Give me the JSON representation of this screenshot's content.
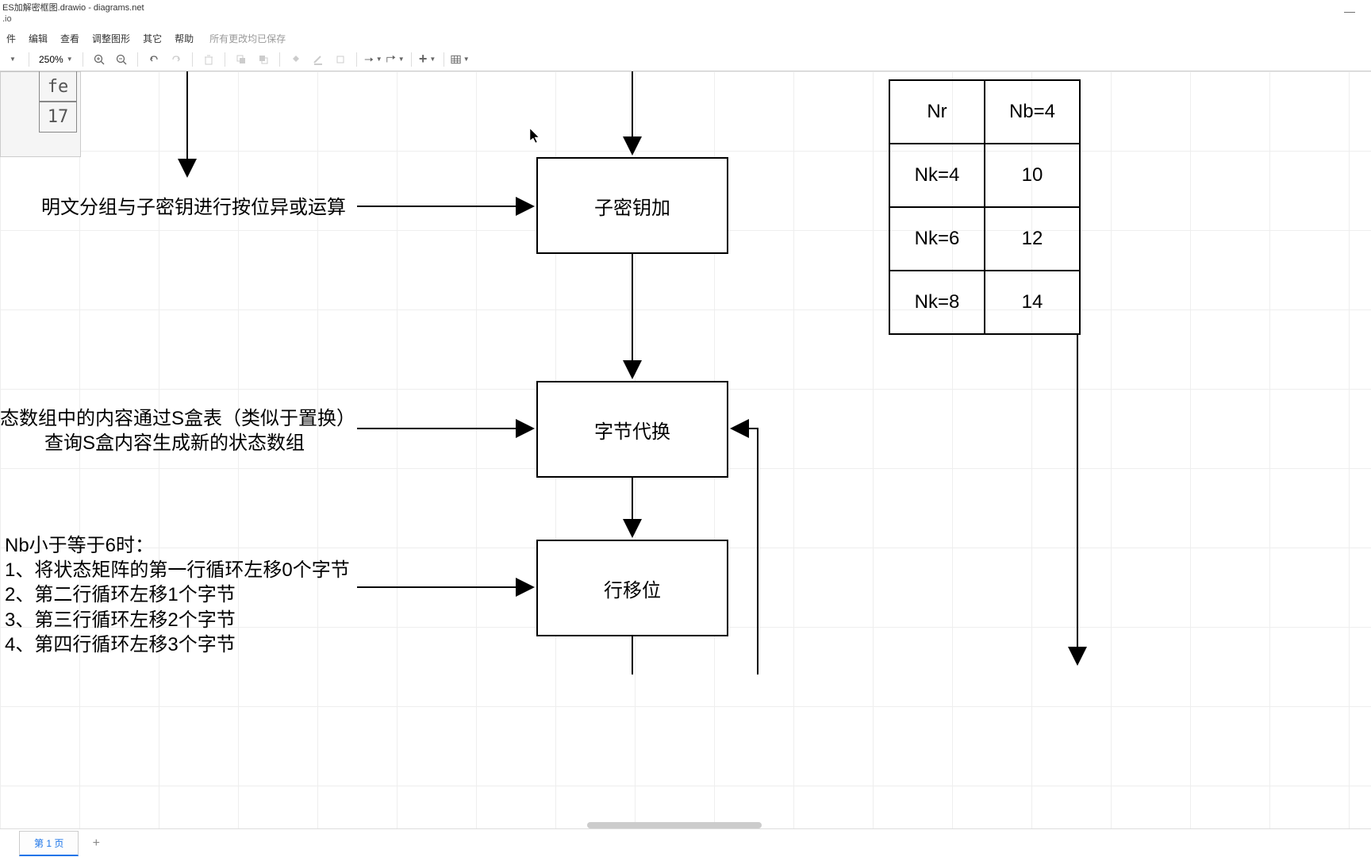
{
  "window": {
    "title": "ES加解密框图.drawio - diagrams.net",
    "subtitle": ".io"
  },
  "menu": {
    "items": [
      "件",
      "编辑",
      "查看",
      "调整图形",
      "其它",
      "帮助"
    ],
    "status": "所有更改均已保存"
  },
  "toolbar": {
    "zoom": "250%"
  },
  "diagram": {
    "thumb": {
      "c1": "fe",
      "c2": "17"
    },
    "box1": "子密钥加",
    "box2": "字节代换",
    "box3": "行移位",
    "text_xor": "明文分组与子密钥进行按位异或运算",
    "text_sbox": "态数组中的内容通过S盒表（类似于置换）\n查询S盒内容生成新的状态数组",
    "text_shift": "Nb小于等于6时：\n1、将状态矩阵的第一行循环左移0个字节\n2、第二行循环左移1个字节\n3、第三行循环左移2个字节\n4、第四行循环左移3个字节",
    "param_table": {
      "header": [
        "Nr",
        "Nb=4"
      ],
      "rows": [
        [
          "Nk=4",
          "10"
        ],
        [
          "Nk=6",
          "12"
        ],
        [
          "Nk=8",
          "14"
        ]
      ]
    }
  },
  "footer": {
    "page": "第 1 页"
  }
}
